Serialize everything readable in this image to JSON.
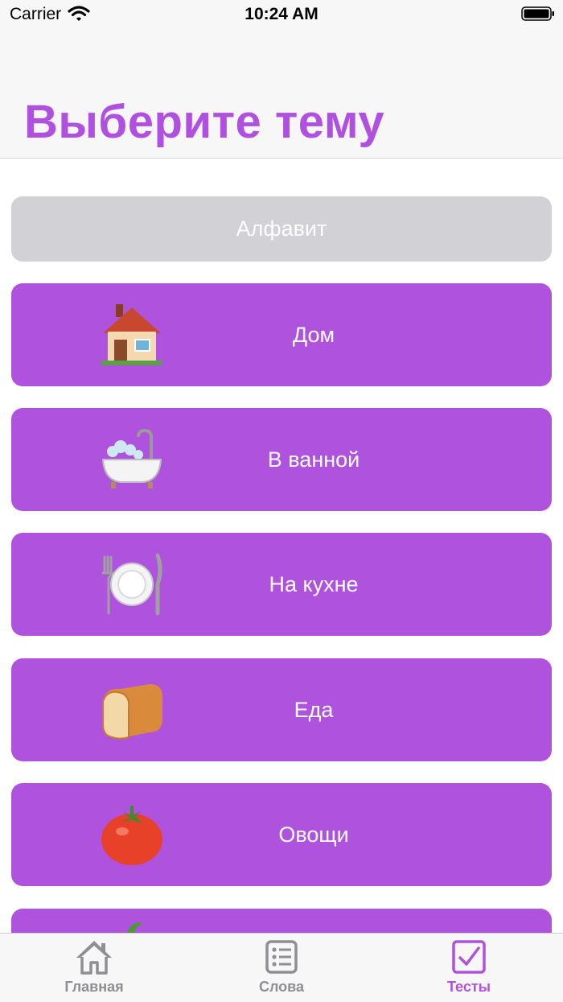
{
  "status_bar": {
    "carrier": "Carrier",
    "time": "10:24 AM"
  },
  "header": {
    "title": "Выберите тему"
  },
  "topics": [
    {
      "label": "Алфавит",
      "icon": null,
      "style": "disabled"
    },
    {
      "label": "Дом",
      "icon": "house-icon"
    },
    {
      "label": "В ванной",
      "icon": "bathtub-icon"
    },
    {
      "label": "На кухне",
      "icon": "plate-cutlery-icon"
    },
    {
      "label": "Еда",
      "icon": "bread-icon"
    },
    {
      "label": "Овощи",
      "icon": "tomato-icon"
    },
    {
      "label": "",
      "icon": "vegetable-icon"
    }
  ],
  "tabs": [
    {
      "label": "Главная",
      "icon": "house-icon",
      "active": false
    },
    {
      "label": "Слова",
      "icon": "list-icon",
      "active": false
    },
    {
      "label": "Тесты",
      "icon": "checkbox-icon",
      "active": true
    }
  ],
  "colors": {
    "accent": "#af52de",
    "disabled": "#d1d1d6",
    "tab_inactive": "#8e8e93"
  }
}
